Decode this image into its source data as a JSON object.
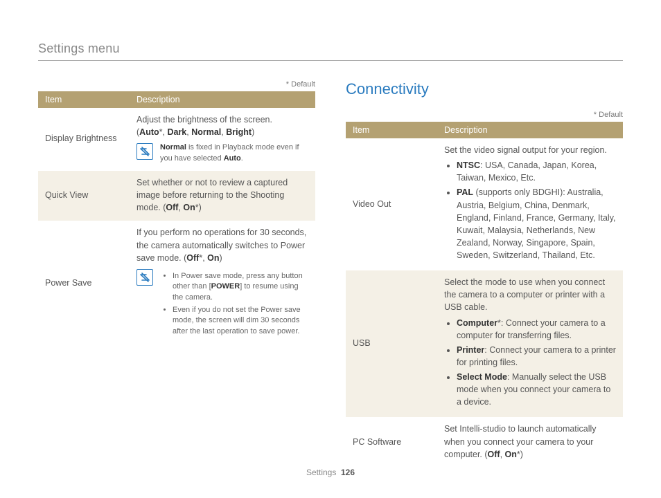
{
  "header": "Settings menu",
  "default_note": "* Default",
  "table_headers": {
    "item": "Item",
    "desc": "Description"
  },
  "left_rows": {
    "r0": {
      "item": "Display Brightness",
      "lead": "Adjust the brightness of the screen.",
      "opt_open": "(",
      "opt_auto": "Auto",
      "opt_star": "*",
      "sep": ", ",
      "opt_dark": "Dark",
      "opt_normal": "Normal",
      "opt_bright": "Bright",
      "opt_close": ")",
      "note_pre": "Normal",
      "note_rest": " is fixed in Playback mode even if you have selected ",
      "note_auto": "Auto",
      "note_end": "."
    },
    "r1": {
      "item": "Quick View",
      "text_a": "Set whether or not to review a captured image before returning to the Shooting mode. (",
      "off": "Off",
      "sep": ", ",
      "on": "On",
      "star": "*",
      "close": ")"
    },
    "r2": {
      "item": "Power Save",
      "text_a": "If you perform no operations for 30 seconds, the camera automatically switches to Power save mode. (",
      "off": "Off",
      "star": "*",
      "sep": ", ",
      "on": "On",
      "close": ")",
      "b1a": "In Power save mode, press any button other than [",
      "b1_power": "POWER",
      "b1b": "] to resume using the camera.",
      "b2": "Even if you do not set the Power save mode, the screen will dim 30 seconds after the last operation to save power."
    }
  },
  "right": {
    "title": "Connectivity",
    "rows": {
      "r0": {
        "item": "Video Out",
        "lead": "Set the video signal output for your region.",
        "b1_label": "NTSC",
        "b1_text": ": USA, Canada, Japan, Korea, Taiwan, Mexico, Etc.",
        "b2_label": "PAL",
        "b2_paren": " (supports only BDGHI): ",
        "b2_text": "Australia, Austria, Belgium, China, Denmark, England, Finland, France, Germany, Italy, Kuwait, Malaysia, Netherlands, New Zealand, Norway, Singapore, Spain, Sweden, Switzerland, Thailand, Etc."
      },
      "r1": {
        "item": "USB",
        "lead": "Select the mode to use when you connect the camera to a computer or printer with a USB cable.",
        "b1_label": "Computer",
        "b1_star": "*",
        "b1_text": ": Connect your camera to a computer for transferring files.",
        "b2_label": "Printer",
        "b2_text": ": Connect your camera to a printer for printing files.",
        "b3_label": "Select Mode",
        "b3_text": ": Manually select the USB mode when you connect your camera to a device."
      },
      "r2": {
        "item": "PC Software",
        "text_a": "Set Intelli-studio to launch automatically when you connect your camera to your computer. (",
        "off": "Off",
        "sep": ", ",
        "on": "On",
        "star": "*",
        "close": ")"
      }
    }
  },
  "footer": {
    "label": "Settings",
    "page": "126"
  }
}
